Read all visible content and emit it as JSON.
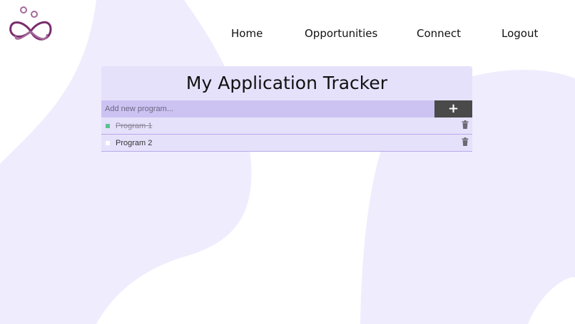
{
  "nav": {
    "home": "Home",
    "opportunities": "Opportunities",
    "connect": "Connect",
    "logout": "Logout"
  },
  "tracker": {
    "title": "My Application Tracker",
    "input_placeholder": "Add new program...",
    "add_button": "+",
    "items": [
      {
        "label": "Program 1",
        "completed": true
      },
      {
        "label": "Program 2",
        "completed": false
      }
    ]
  },
  "colors": {
    "background_blob": "#efecfd",
    "card": "#e6e1fb",
    "input_row": "#cdc3f3",
    "add_button": "#4a4a4a",
    "done_check": "#5cc28f",
    "logo": "#7b2d6e"
  },
  "icons": {
    "logo": "butterfly-logo-icon",
    "add": "plus-icon",
    "delete": "trash-icon"
  }
}
